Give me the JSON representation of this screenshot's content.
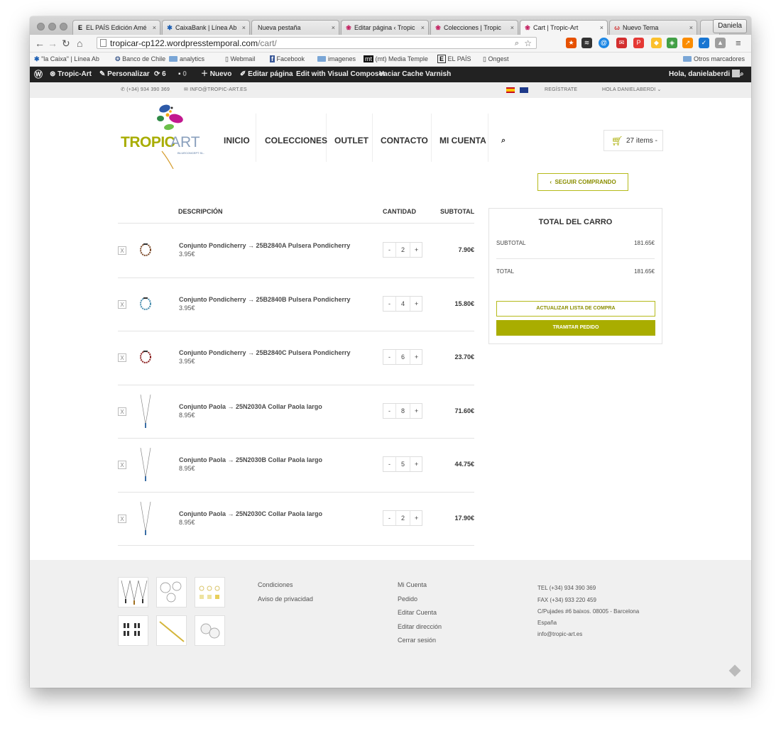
{
  "browser": {
    "tabs": [
      {
        "label": "EL PAÍS Edición Amé",
        "icon": "E"
      },
      {
        "label": "CaixaBank | Línea Ab",
        "icon": "✱"
      },
      {
        "label": "Nueva pestaña",
        "icon": ""
      },
      {
        "label": "Editar página ‹ Tropic",
        "icon": "❀"
      },
      {
        "label": "Colecciones | Tropic",
        "icon": "❀"
      },
      {
        "label": "Cart | Tropic-Art",
        "icon": "❀"
      },
      {
        "label": "Nuevo Tema",
        "icon": "ω"
      }
    ],
    "user": "Daniela",
    "url_host": "tropicar-cp122.wordpresstemporal.com",
    "url_path": "/cart/",
    "bookmarks": [
      "\"la Caixa\" | Línea Ab",
      "Banco de Chile",
      "analytics",
      "Webmail",
      "Facebook",
      "imagenes",
      "(mt) Media Temple",
      "EL PAÍS",
      "Ongest"
    ],
    "other_bookmarks": "Otros marcadores"
  },
  "adminbar": {
    "site": "Tropic-Art",
    "customize": "Personalizar",
    "updates": "6",
    "comments": "0",
    "new": "Nuevo",
    "edit": "Editar página",
    "composer": "Edit with Visual Composer",
    "varnish": "Vaciar Cache Varnish",
    "greeting": "Hola, danielaberdi"
  },
  "topbar": {
    "phone": "(+34) 934 390 369",
    "email": "INFO@TROPIC-ART.ES",
    "register": "REGÍSTRATE",
    "hello": "HOLA DANIELABERDI"
  },
  "header": {
    "logo_main": "TROPIC",
    "logo_art": "ART",
    "logo_sub": "BLUECONCEPT SL.",
    "nav": [
      "INICIO",
      "COLECCIONES",
      "OUTLET",
      "CONTACTO",
      "MI CUENTA"
    ],
    "cart_label": "27 items -"
  },
  "cart": {
    "continue": "SEGUIR COMPRANDO",
    "col_desc": "DESCRIPCIÓN",
    "col_qty": "CANTIDAD",
    "col_sub": "SUBTOTAL",
    "items": [
      {
        "name": "Conjunto Pondicherry → 25B2840A Pulsera Pondicherry",
        "price": "3.95€",
        "qty": "2",
        "subtotal": "7.90€",
        "remove": "X",
        "kind": "bracelet-brown"
      },
      {
        "name": "Conjunto Pondicherry → 25B2840B Pulsera Pondicherry",
        "price": "3.95€",
        "qty": "4",
        "subtotal": "15.80€",
        "remove": "X",
        "kind": "bracelet-blue"
      },
      {
        "name": "Conjunto Pondicherry → 25B2840C Pulsera Pondicherry",
        "price": "3.95€",
        "qty": "6",
        "subtotal": "23.70€",
        "remove": "X",
        "kind": "bracelet-red"
      },
      {
        "name": "Conjunto Paola → 25N2030A Collar Paola largo",
        "price": "8.95€",
        "qty": "8",
        "subtotal": "71.60€",
        "remove": "X",
        "kind": "necklace"
      },
      {
        "name": "Conjunto Paola → 25N2030B Collar Paola largo",
        "price": "8.95€",
        "qty": "5",
        "subtotal": "44.75€",
        "remove": "X",
        "kind": "necklace"
      },
      {
        "name": "Conjunto Paola → 25N2030C Collar Paola largo",
        "price": "8.95€",
        "qty": "2",
        "subtotal": "17.90€",
        "remove": "X",
        "kind": "necklace"
      }
    ],
    "minus": "-",
    "plus": "+"
  },
  "totals": {
    "title": "TOTAL DEL CARRO",
    "subtotal_label": "SUBTOTAL",
    "subtotal_value": "181.65€",
    "total_label": "TOTAL",
    "total_value": "181.65€",
    "update": "ACTUALIZAR LISTA DE COMPRA",
    "checkout": "TRAMITAR PEDIDO"
  },
  "footer": {
    "links1": [
      "Condiciones",
      "Aviso de privacidad"
    ],
    "links2": [
      "Mi Cuenta",
      "Pedido",
      "Editar Cuenta",
      "Editar dirección",
      "Cerrar sesión"
    ],
    "contact": [
      "TEL (+34) 934 390 369",
      "FAX (+34) 933 220 459",
      "C/Pujades #6 baixos. 08005 - Barcelona",
      "España",
      "info@tropic-art.es"
    ]
  },
  "colors": {
    "brand_green": "#a9ad00",
    "brand_blue": "#8aa0bd",
    "adminbar": "#222222"
  }
}
